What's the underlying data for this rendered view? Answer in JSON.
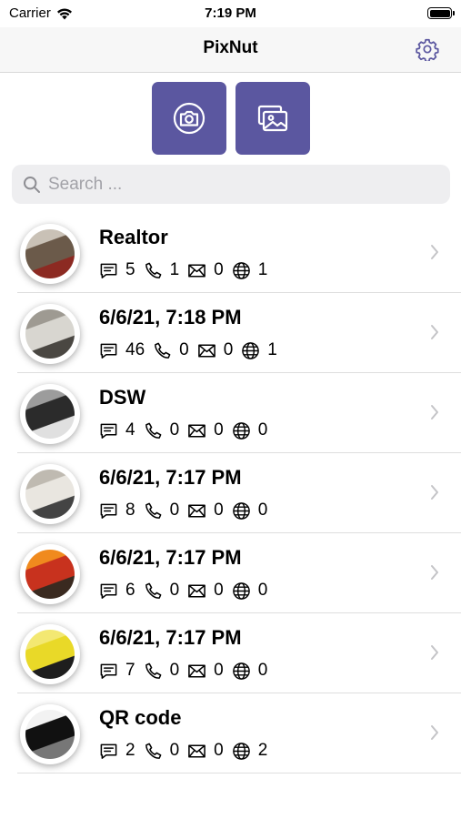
{
  "status_bar": {
    "carrier": "Carrier",
    "time": "7:19 PM"
  },
  "nav": {
    "title": "PixNut",
    "settings_icon": "gear-icon"
  },
  "actions": [
    {
      "name": "camera-button",
      "icon": "camera-icon"
    },
    {
      "name": "photo-library-button",
      "icon": "photos-icon"
    }
  ],
  "search": {
    "placeholder": "Search ..."
  },
  "colors": {
    "accent": "#5b57a0",
    "search_bg": "#eeeef0"
  },
  "items": [
    {
      "title": "Realtor",
      "texts": "5",
      "phones": "1",
      "emails": "0",
      "urls": "1",
      "thumb": [
        "#6b5a4a",
        "#c9c1b6",
        "#8c2a22"
      ]
    },
    {
      "title": "6/6/21, 7:18 PM",
      "texts": "46",
      "phones": "0",
      "emails": "0",
      "urls": "1",
      "thumb": [
        "#d8d6d0",
        "#9e9a92",
        "#4a4742"
      ]
    },
    {
      "title": "DSW",
      "texts": "4",
      "phones": "0",
      "emails": "0",
      "urls": "0",
      "thumb": [
        "#2b2b2b",
        "#9c9c9c",
        "#e0e0e0"
      ]
    },
    {
      "title": "6/6/21, 7:17 PM",
      "texts": "8",
      "phones": "0",
      "emails": "0",
      "urls": "0",
      "thumb": [
        "#e9e6e0",
        "#bfbab1",
        "#444"
      ]
    },
    {
      "title": "6/6/21, 7:17 PM",
      "texts": "6",
      "phones": "0",
      "emails": "0",
      "urls": "0",
      "thumb": [
        "#c8321e",
        "#f08a1e",
        "#3a2a20"
      ]
    },
    {
      "title": "6/6/21, 7:17 PM",
      "texts": "7",
      "phones": "0",
      "emails": "0",
      "urls": "0",
      "thumb": [
        "#e9d928",
        "#f3e872",
        "#1e1e1e"
      ]
    },
    {
      "title": "QR code",
      "texts": "2",
      "phones": "0",
      "emails": "0",
      "urls": "2",
      "thumb": [
        "#111111",
        "#f2f2f2",
        "#777777"
      ]
    }
  ]
}
